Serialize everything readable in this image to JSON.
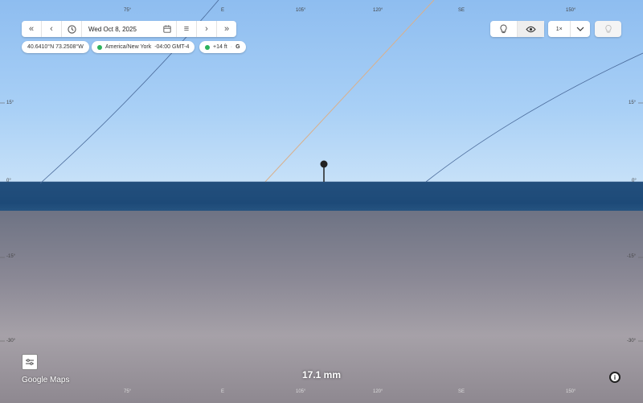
{
  "toolbar": {
    "date": "Wed Oct 8, 2025",
    "icons": [
      "double-chevron-left-icon",
      "chevron-left-icon",
      "clock-icon",
      "calendar-icon",
      "menu-icon",
      "chevron-right-icon",
      "double-chevron-right-icon"
    ]
  },
  "info_pills": {
    "coordinates": "40.6410°N 73.2508°W",
    "timezone": "America/New York",
    "utc_offset": "-04:00 GMT-4",
    "elevation": "+14 ft",
    "elevation_source": "G"
  },
  "right_controls": {
    "speed": "1×",
    "icons": [
      "bulb-outline-icon",
      "eye-icon",
      "chevron-down-icon",
      "lightbulb-icon"
    ]
  },
  "compass_top": [
    "75°",
    "E",
    "105°",
    "120°",
    "SE",
    "150°"
  ],
  "compass_bottom": [
    "75°",
    "E",
    "105°",
    "120°",
    "SE",
    "150°"
  ],
  "altitude_left": [
    "15°",
    "0°",
    "-15°",
    "-30°"
  ],
  "altitude_right": [
    "15°",
    "0°",
    "-15°",
    "-30°"
  ],
  "focal_length": "17.1 mm",
  "brand": "Google Maps",
  "colors": {
    "status_dot": "#2db25c",
    "sky": "#9cc4ee",
    "sea": "#1d4a78"
  }
}
